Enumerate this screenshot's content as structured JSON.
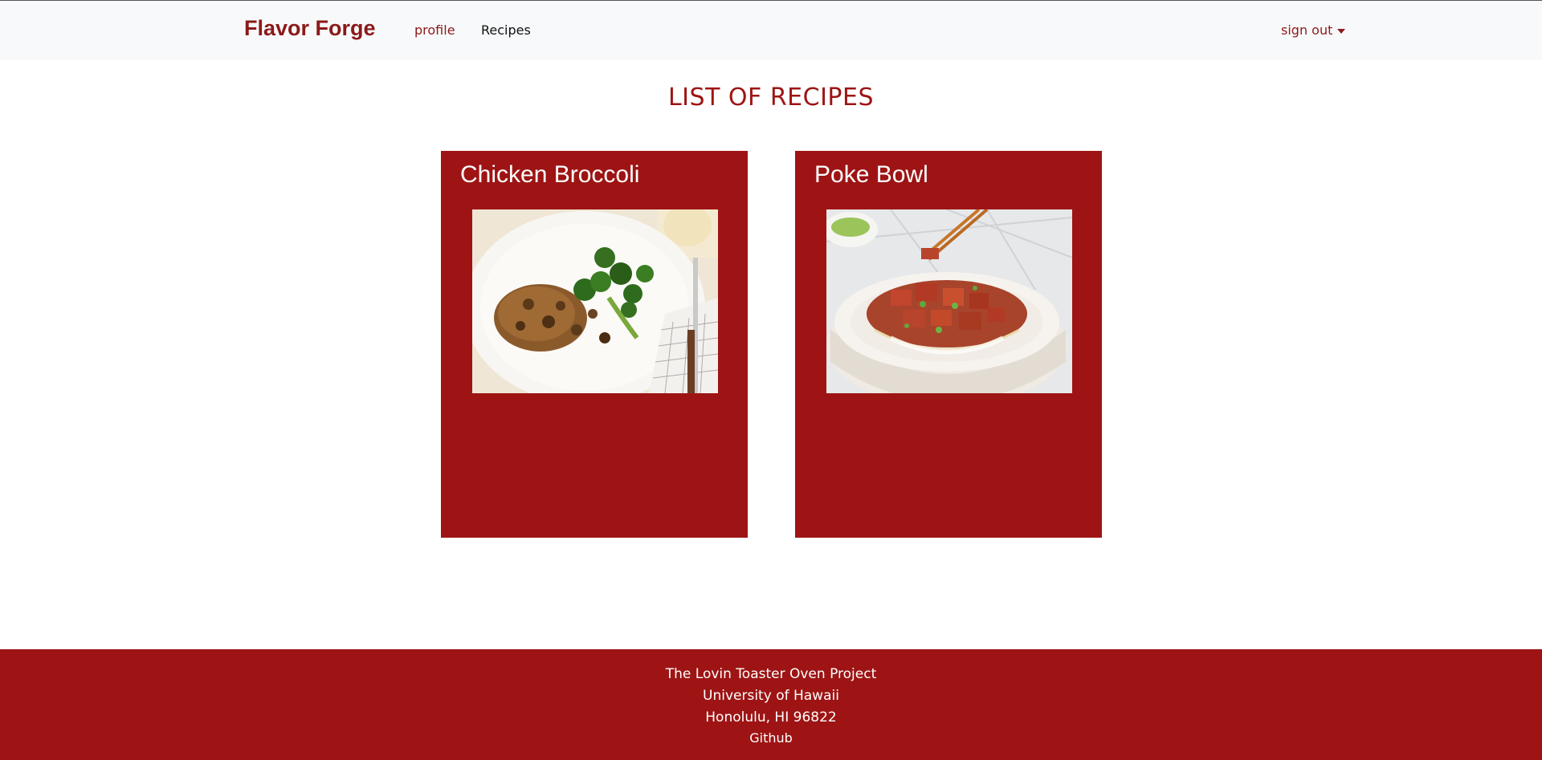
{
  "navbar": {
    "brand": "Flavor Forge",
    "links": [
      {
        "label": "profile"
      },
      {
        "label": "Recipes"
      }
    ],
    "signout_label": "sign out"
  },
  "main": {
    "title": "LIST OF RECIPES",
    "recipes": [
      {
        "title": "Chicken Broccoli",
        "image": "chicken-broccoli-plate-photo"
      },
      {
        "title": "Poke Bowl",
        "image": "poke-bowl-photo"
      }
    ]
  },
  "footer": {
    "lines": [
      "The Lovin Toaster Oven Project",
      "University of Hawaii",
      "Honolulu, HI 96822"
    ],
    "link_label": "Github"
  },
  "colors": {
    "brand_red": "#9e1414",
    "navbar_bg": "#f8f9fa",
    "text_white": "#ffffff"
  }
}
